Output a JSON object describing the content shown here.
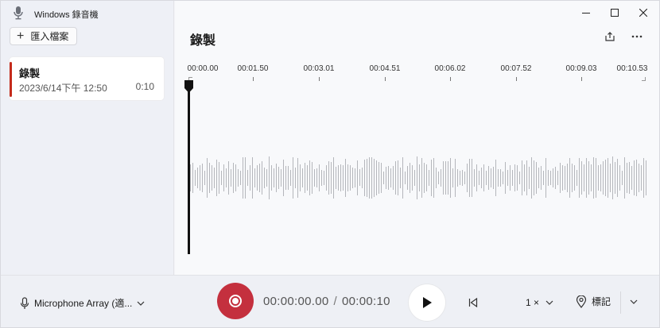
{
  "app": {
    "title": "Windows 錄音機"
  },
  "sidebar": {
    "import_label": "匯入檔案",
    "recordings": [
      {
        "name": "錄製",
        "date": "2023/6/14下午 12:50",
        "duration": "0:10"
      }
    ]
  },
  "main": {
    "title": "錄製",
    "ticks": [
      "00:00.00",
      "00:01.50",
      "00:03.01",
      "00:04.51",
      "00:06.02",
      "00:07.52",
      "00:09.03",
      "00:10.53"
    ]
  },
  "bottom": {
    "microphone": "Microphone Array (適...",
    "current_time": "00:00:00.00",
    "time_separator": "/",
    "total_time": "00:00:10",
    "speed": "1 ×",
    "mark_label": "標記"
  },
  "colors": {
    "accent": "#c42b1c",
    "record_button": "#c4303e",
    "waveform": "#b4b6bb"
  },
  "icons": [
    "microphone-icon",
    "plus-icon",
    "minimize-icon",
    "maximize-icon",
    "close-icon",
    "share-icon",
    "more-icon",
    "record-icon",
    "play-icon",
    "skip-back-icon",
    "chevron-down-icon",
    "location-pin-icon"
  ]
}
